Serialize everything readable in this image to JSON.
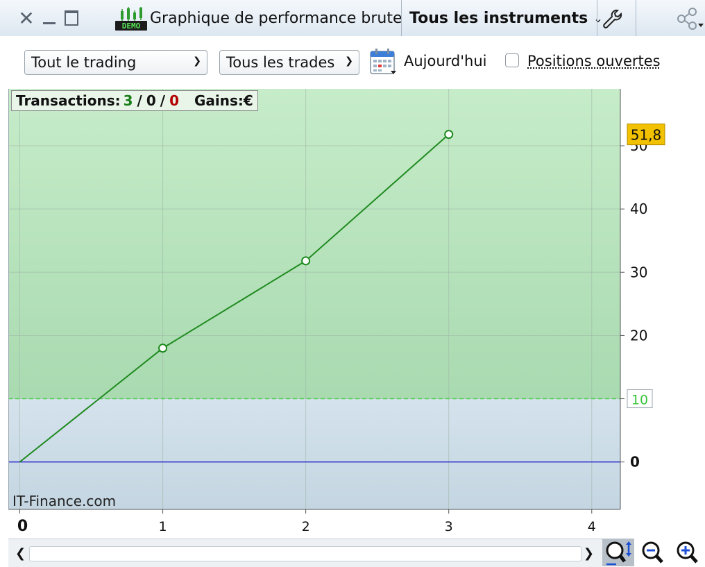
{
  "window": {
    "title": "Graphique de performance brute",
    "instruments_label": "Tous les instruments",
    "demo_badge": "DEMO"
  },
  "filters": {
    "trading_select": "Tout le trading",
    "trades_select": "Tous les trades",
    "date_label": "Aujourd'hui",
    "open_positions_label": "Positions ouvertes",
    "open_positions_checked": false
  },
  "stats": {
    "transactions_label": "Transactions:",
    "total": "3",
    "sep": "/",
    "neutral": "0",
    "losses": "0",
    "gains_label": "Gains:",
    "gains_currency": "€"
  },
  "watermark": "IT-Finance.com",
  "colors": {
    "profit_zone": "#c6ecc9",
    "loss_zone": "#d4e2ec",
    "series_line": "#1e8a1e",
    "zero_line": "#2a2acc",
    "threshold_line": "#4ccf4c",
    "last_value_badge": "#f2c200"
  },
  "chart_data": {
    "type": "line",
    "x": [
      0,
      1,
      2,
      3
    ],
    "y": [
      0,
      18,
      31.8,
      51.8
    ],
    "xlim": [
      -0.08,
      4.2
    ],
    "ylim": [
      -7.5,
      59
    ],
    "x_ticks": [
      "0",
      "1",
      "2",
      "3",
      "4"
    ],
    "y_ticks": [
      "0",
      "10",
      "20",
      "30",
      "40",
      "50"
    ],
    "threshold": 10,
    "threshold_label": "10",
    "last_value_label": "51,8",
    "grid": true,
    "y_axis_position": "right"
  }
}
